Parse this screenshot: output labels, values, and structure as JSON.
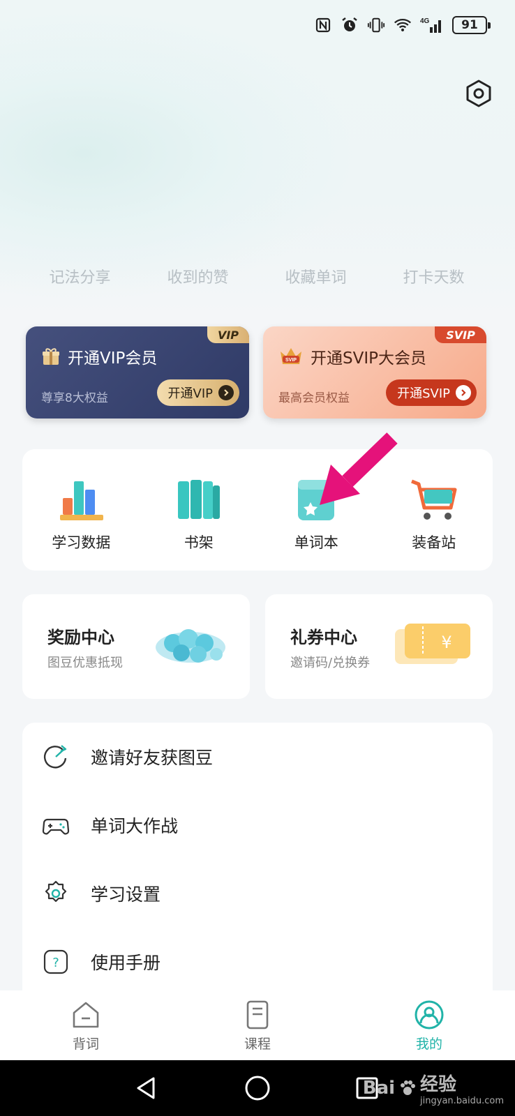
{
  "status_bar": {
    "battery": "91",
    "network": "4G"
  },
  "stats": [
    {
      "label": "记法分享"
    },
    {
      "label": "收到的赞"
    },
    {
      "label": "收藏单词"
    },
    {
      "label": "打卡天数"
    }
  ],
  "vip_card": {
    "tag": "VIP",
    "title": "开通VIP会员",
    "subtitle": "尊享8大权益",
    "button": "开通VIP"
  },
  "svip_card": {
    "tag": "SVIP",
    "title": "开通SVIP大会员",
    "subtitle": "最高会员权益",
    "button": "开通SVIP"
  },
  "grid": [
    {
      "label": "学习数据",
      "icon": "bar-chart-icon"
    },
    {
      "label": "书架",
      "icon": "bookshelf-icon"
    },
    {
      "label": "单词本",
      "icon": "wordbook-icon"
    },
    {
      "label": "装备站",
      "icon": "shopping-cart-icon"
    }
  ],
  "reward": {
    "title": "奖励中心",
    "subtitle": "图豆优惠抵现"
  },
  "coupon": {
    "title": "礼券中心",
    "subtitle": "邀请码/兑换券"
  },
  "list": [
    {
      "label": "邀请好友获图豆",
      "icon": "invite-icon"
    },
    {
      "label": "单词大作战",
      "icon": "gamepad-icon"
    },
    {
      "label": "学习设置",
      "icon": "gear-icon"
    },
    {
      "label": "使用手册",
      "icon": "help-icon"
    }
  ],
  "tabs": [
    {
      "label": "背词",
      "icon": "home-icon",
      "active": false
    },
    {
      "label": "课程",
      "icon": "book-icon",
      "active": false
    },
    {
      "label": "我的",
      "icon": "profile-icon",
      "active": true
    }
  ],
  "watermark": {
    "brand": "Bai",
    "brand2": "经验",
    "url": "jingyan.baidu.com"
  },
  "colors": {
    "accent": "#21b3a8",
    "pointer": "#e5127a"
  }
}
